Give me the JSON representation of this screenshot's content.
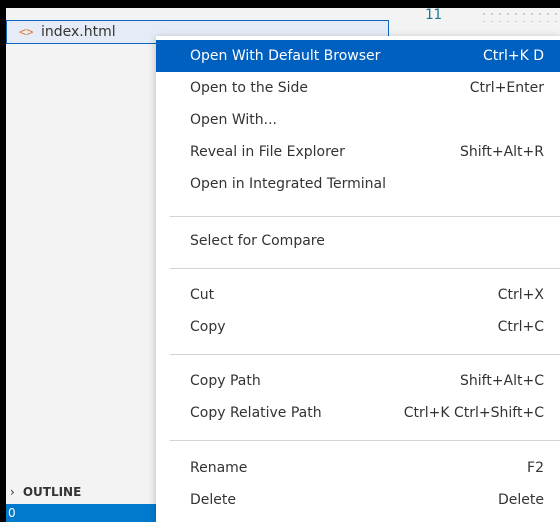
{
  "explorer": {
    "file": {
      "icon": "html-file-icon",
      "name": "index.html"
    },
    "outline_label": "OUTLINE",
    "outline_chevron": "chevron-right-icon"
  },
  "editor": {
    "line_number": "11"
  },
  "status": {
    "count": "0"
  },
  "colors": {
    "accent": "#0060c0",
    "statusbar": "#007acc",
    "file_icon": "#e37933",
    "line_number": "#237893"
  },
  "context_menu": {
    "items": [
      {
        "label": "Open With Default Browser",
        "shortcut": "Ctrl+K D"
      },
      {
        "label": "Open to the Side",
        "shortcut": "Ctrl+Enter"
      },
      {
        "label": "Open With...",
        "shortcut": ""
      },
      {
        "label": "Reveal in File Explorer",
        "shortcut": "Shift+Alt+R"
      },
      {
        "label": "Open in Integrated Terminal",
        "shortcut": ""
      },
      {
        "label": "Select for Compare",
        "shortcut": ""
      },
      {
        "label": "Cut",
        "shortcut": "Ctrl+X"
      },
      {
        "label": "Copy",
        "shortcut": "Ctrl+C"
      },
      {
        "label": "Copy Path",
        "shortcut": "Shift+Alt+C"
      },
      {
        "label": "Copy Relative Path",
        "shortcut": "Ctrl+K Ctrl+Shift+C"
      },
      {
        "label": "Rename",
        "shortcut": "F2"
      },
      {
        "label": "Delete",
        "shortcut": "Delete"
      }
    ]
  }
}
